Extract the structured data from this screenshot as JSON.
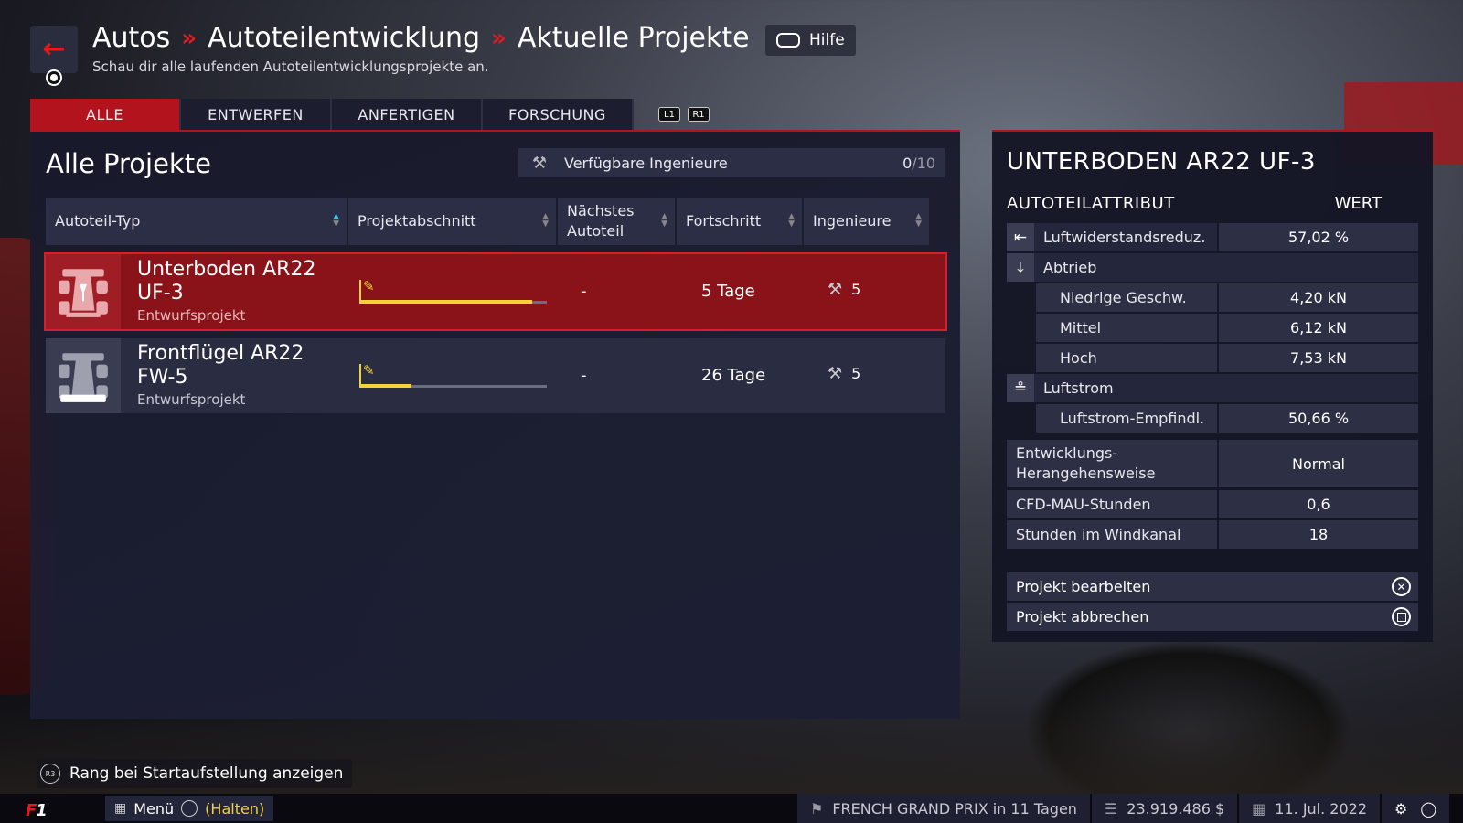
{
  "header": {
    "breadcrumbs": [
      "Autos",
      "Autoteilentwicklung",
      "Aktuelle Projekte"
    ],
    "separator": "»",
    "subtitle": "Schau dir alle laufenden Autoteilentwicklungsprojekte an.",
    "help_label": "Hilfe"
  },
  "tabs": [
    {
      "label": "ALLE",
      "active": true
    },
    {
      "label": "ENTWERFEN",
      "active": false
    },
    {
      "label": "ANFERTIGEN",
      "active": false
    },
    {
      "label": "FORSCHUNG",
      "active": false
    }
  ],
  "shoulder_buttons": [
    "L1",
    "R1"
  ],
  "projects_panel": {
    "title": "Alle Projekte",
    "available_engineers_label": "Verfügbare Ingenieure",
    "available_engineers_current": "0",
    "available_engineers_total": "/10",
    "columns": [
      "Autoteil-Typ",
      "Projektabschnitt",
      "Nächstes Autoteil",
      "Fortschritt",
      "Ingenieure"
    ],
    "rows": [
      {
        "name": "Unterboden AR22 UF-3",
        "type": "Entwurfsprojekt",
        "phase_progress": 0.92,
        "next_part": "-",
        "progress": "5 Tage",
        "engineers": "5",
        "selected": true
      },
      {
        "name": "Frontflügel AR22 FW-5",
        "type": "Entwurfsprojekt",
        "phase_progress": 0.28,
        "next_part": "-",
        "progress": "26 Tage",
        "engineers": "5",
        "selected": false
      }
    ]
  },
  "detail_panel": {
    "title": "UNTERBODEN AR22 UF-3",
    "col_attribute": "AUTOTEILATTRIBUT",
    "col_value": "WERT",
    "drag_reduction_label": "Luftwiderstandsreduz.",
    "drag_reduction_value": "57,02 %",
    "downforce_label": "Abtrieb",
    "downforce_low_label": "Niedrige Geschw.",
    "downforce_low_value": "4,20 kN",
    "downforce_mid_label": "Mittel",
    "downforce_mid_value": "6,12 kN",
    "downforce_high_label": "Hoch",
    "downforce_high_value": "7,53 kN",
    "airflow_label": "Luftstrom",
    "airflow_sens_label": "Luftstrom-Empfindl.",
    "airflow_sens_value": "50,66 %",
    "approach_label": "Entwicklungs-Herangehensweise",
    "approach_value": "Normal",
    "cfd_label": "CFD-MAU-Stunden",
    "cfd_value": "0,6",
    "wind_label": "Stunden im Windkanal",
    "wind_value": "18",
    "edit_label": "Projekt bearbeiten",
    "cancel_label": "Projekt abbrechen"
  },
  "footer": {
    "r3_hint": "Rang bei Startaufstellung anzeigen",
    "r3_glyph": "R3",
    "menu_label": "Menü",
    "hold_label": "(Halten)",
    "next_race": "FRENCH GRAND PRIX in 11 Tagen",
    "budget": "23.919.486 $",
    "date": "11. Jul. 2022"
  },
  "colors": {
    "accent_red": "#b2131c",
    "progress_yellow": "#f3d23a",
    "sort_active": "#3ec6e0"
  }
}
